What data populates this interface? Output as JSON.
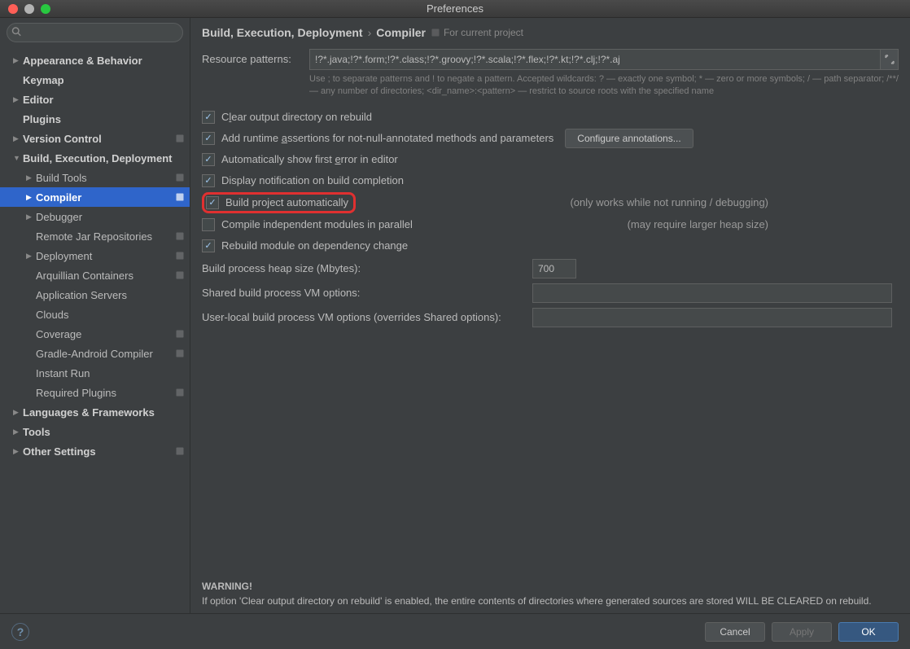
{
  "window": {
    "title": "Preferences"
  },
  "sidebar": {
    "search_placeholder": "",
    "items": [
      {
        "label": "Appearance & Behavior",
        "arrow": "▶",
        "bold": true,
        "indent": 0
      },
      {
        "label": "Keymap",
        "arrow": "",
        "bold": true,
        "indent": 0
      },
      {
        "label": "Editor",
        "arrow": "▶",
        "bold": true,
        "indent": 0
      },
      {
        "label": "Plugins",
        "arrow": "",
        "bold": true,
        "indent": 0
      },
      {
        "label": "Version Control",
        "arrow": "▶",
        "bold": true,
        "indent": 0,
        "proj": true
      },
      {
        "label": "Build, Execution, Deployment",
        "arrow": "▼",
        "bold": true,
        "indent": 0
      },
      {
        "label": "Build Tools",
        "arrow": "▶",
        "bold": false,
        "indent": 1,
        "proj": true
      },
      {
        "label": "Compiler",
        "arrow": "▶",
        "bold": false,
        "indent": 1,
        "proj": true,
        "selected": true
      },
      {
        "label": "Debugger",
        "arrow": "▶",
        "bold": false,
        "indent": 1
      },
      {
        "label": "Remote Jar Repositories",
        "arrow": "",
        "bold": false,
        "indent": 1,
        "proj": true
      },
      {
        "label": "Deployment",
        "arrow": "▶",
        "bold": false,
        "indent": 1,
        "proj": true
      },
      {
        "label": "Arquillian Containers",
        "arrow": "",
        "bold": false,
        "indent": 1,
        "proj": true
      },
      {
        "label": "Application Servers",
        "arrow": "",
        "bold": false,
        "indent": 1
      },
      {
        "label": "Clouds",
        "arrow": "",
        "bold": false,
        "indent": 1
      },
      {
        "label": "Coverage",
        "arrow": "",
        "bold": false,
        "indent": 1,
        "proj": true
      },
      {
        "label": "Gradle-Android Compiler",
        "arrow": "",
        "bold": false,
        "indent": 1,
        "proj": true
      },
      {
        "label": "Instant Run",
        "arrow": "",
        "bold": false,
        "indent": 1
      },
      {
        "label": "Required Plugins",
        "arrow": "",
        "bold": false,
        "indent": 1,
        "proj": true
      },
      {
        "label": "Languages & Frameworks",
        "arrow": "▶",
        "bold": true,
        "indent": 0
      },
      {
        "label": "Tools",
        "arrow": "▶",
        "bold": true,
        "indent": 0
      },
      {
        "label": "Other Settings",
        "arrow": "▶",
        "bold": true,
        "indent": 0,
        "proj": true
      }
    ]
  },
  "breadcrumb": {
    "a": "Build, Execution, Deployment",
    "b": "Compiler",
    "scope": "For current project"
  },
  "form": {
    "resource_patterns_label": "Resource patterns:",
    "resource_patterns_value": "!?*.java;!?*.form;!?*.class;!?*.groovy;!?*.scala;!?*.flex;!?*.kt;!?*.clj;!?*.aj",
    "hint": "Use ; to separate patterns and ! to negate a pattern. Accepted wildcards: ? — exactly one symbol; * — zero or more symbols; / — path separator; /**/ — any number of directories; <dir_name>:<pattern> — restrict to source roots with the specified name",
    "chk_clear": "Clear output directory on rebuild",
    "chk_assert": "Add runtime assertions for not-null-annotated methods and parameters",
    "btn_configure": "Configure annotations...",
    "chk_autoerr": "Automatically show first error in editor",
    "chk_notify": "Display notification on build completion",
    "chk_autobuild": "Build project automatically",
    "note_autobuild": "(only works while not running / debugging)",
    "chk_parallel": "Compile independent modules in parallel",
    "note_parallel": "(may require larger heap size)",
    "chk_rebuild_dep": "Rebuild module on dependency change",
    "heap_label": "Build process heap size (Mbytes):",
    "heap_value": "700",
    "shared_vm_label": "Shared build process VM options:",
    "shared_vm_value": "",
    "user_vm_label": "User-local build process VM options (overrides Shared options):",
    "user_vm_value": ""
  },
  "warning": {
    "title": "WARNING!",
    "body": "If option 'Clear output directory on rebuild' is enabled, the entire contents of directories where generated sources are stored WILL BE CLEARED on rebuild."
  },
  "buttons": {
    "cancel": "Cancel",
    "apply": "Apply",
    "ok": "OK"
  }
}
